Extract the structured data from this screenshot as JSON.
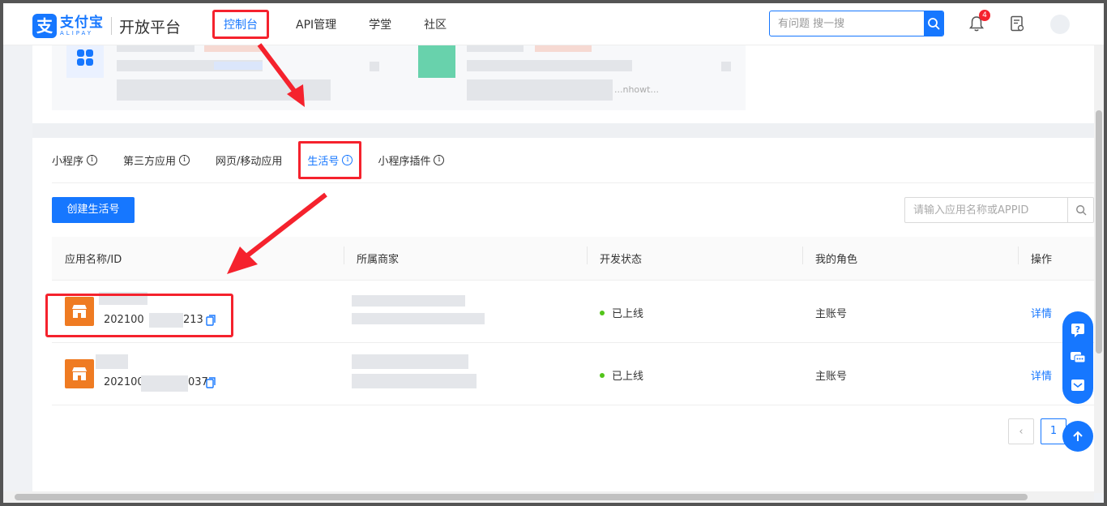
{
  "header": {
    "logo_cn": "支付宝",
    "logo_en": "ALIPAY",
    "platform": "开放平台",
    "nav": [
      "控制台",
      "API管理",
      "学堂",
      "社区"
    ],
    "search_placeholder": "有问题 搜一搜",
    "notification_count": "4"
  },
  "cards": {
    "truncated_text": "...nhowt..."
  },
  "tabs": [
    "小程序",
    "第三方应用",
    "网页/移动应用",
    "生活号",
    "小程序插件"
  ],
  "toolbar": {
    "create_label": "创建生活号",
    "search_placeholder": "请输入应用名称或APPID"
  },
  "table": {
    "columns": [
      "应用名称/ID",
      "所属商家",
      "开发状态",
      "我的角色",
      "操作"
    ],
    "rows": [
      {
        "id_prefix": "202100",
        "id_suffix": "213",
        "status": "已上线",
        "role": "主账号",
        "action": "详情"
      },
      {
        "id_prefix": "202100",
        "id_suffix": "037",
        "status": "已上线",
        "role": "主账号",
        "action": "详情"
      }
    ]
  },
  "pagination": {
    "current_page": "1"
  },
  "colors": {
    "primary": "#1677ff",
    "annotation_red": "#f5222d",
    "status_green": "#52c41a",
    "shop_orange": "#ef7b22"
  },
  "icons": [
    "search-icon",
    "bell-icon",
    "document-icon",
    "info-icon",
    "shop-icon",
    "copy-icon",
    "help-icon",
    "chat-icon",
    "feedback-icon",
    "arrow-up-icon"
  ]
}
